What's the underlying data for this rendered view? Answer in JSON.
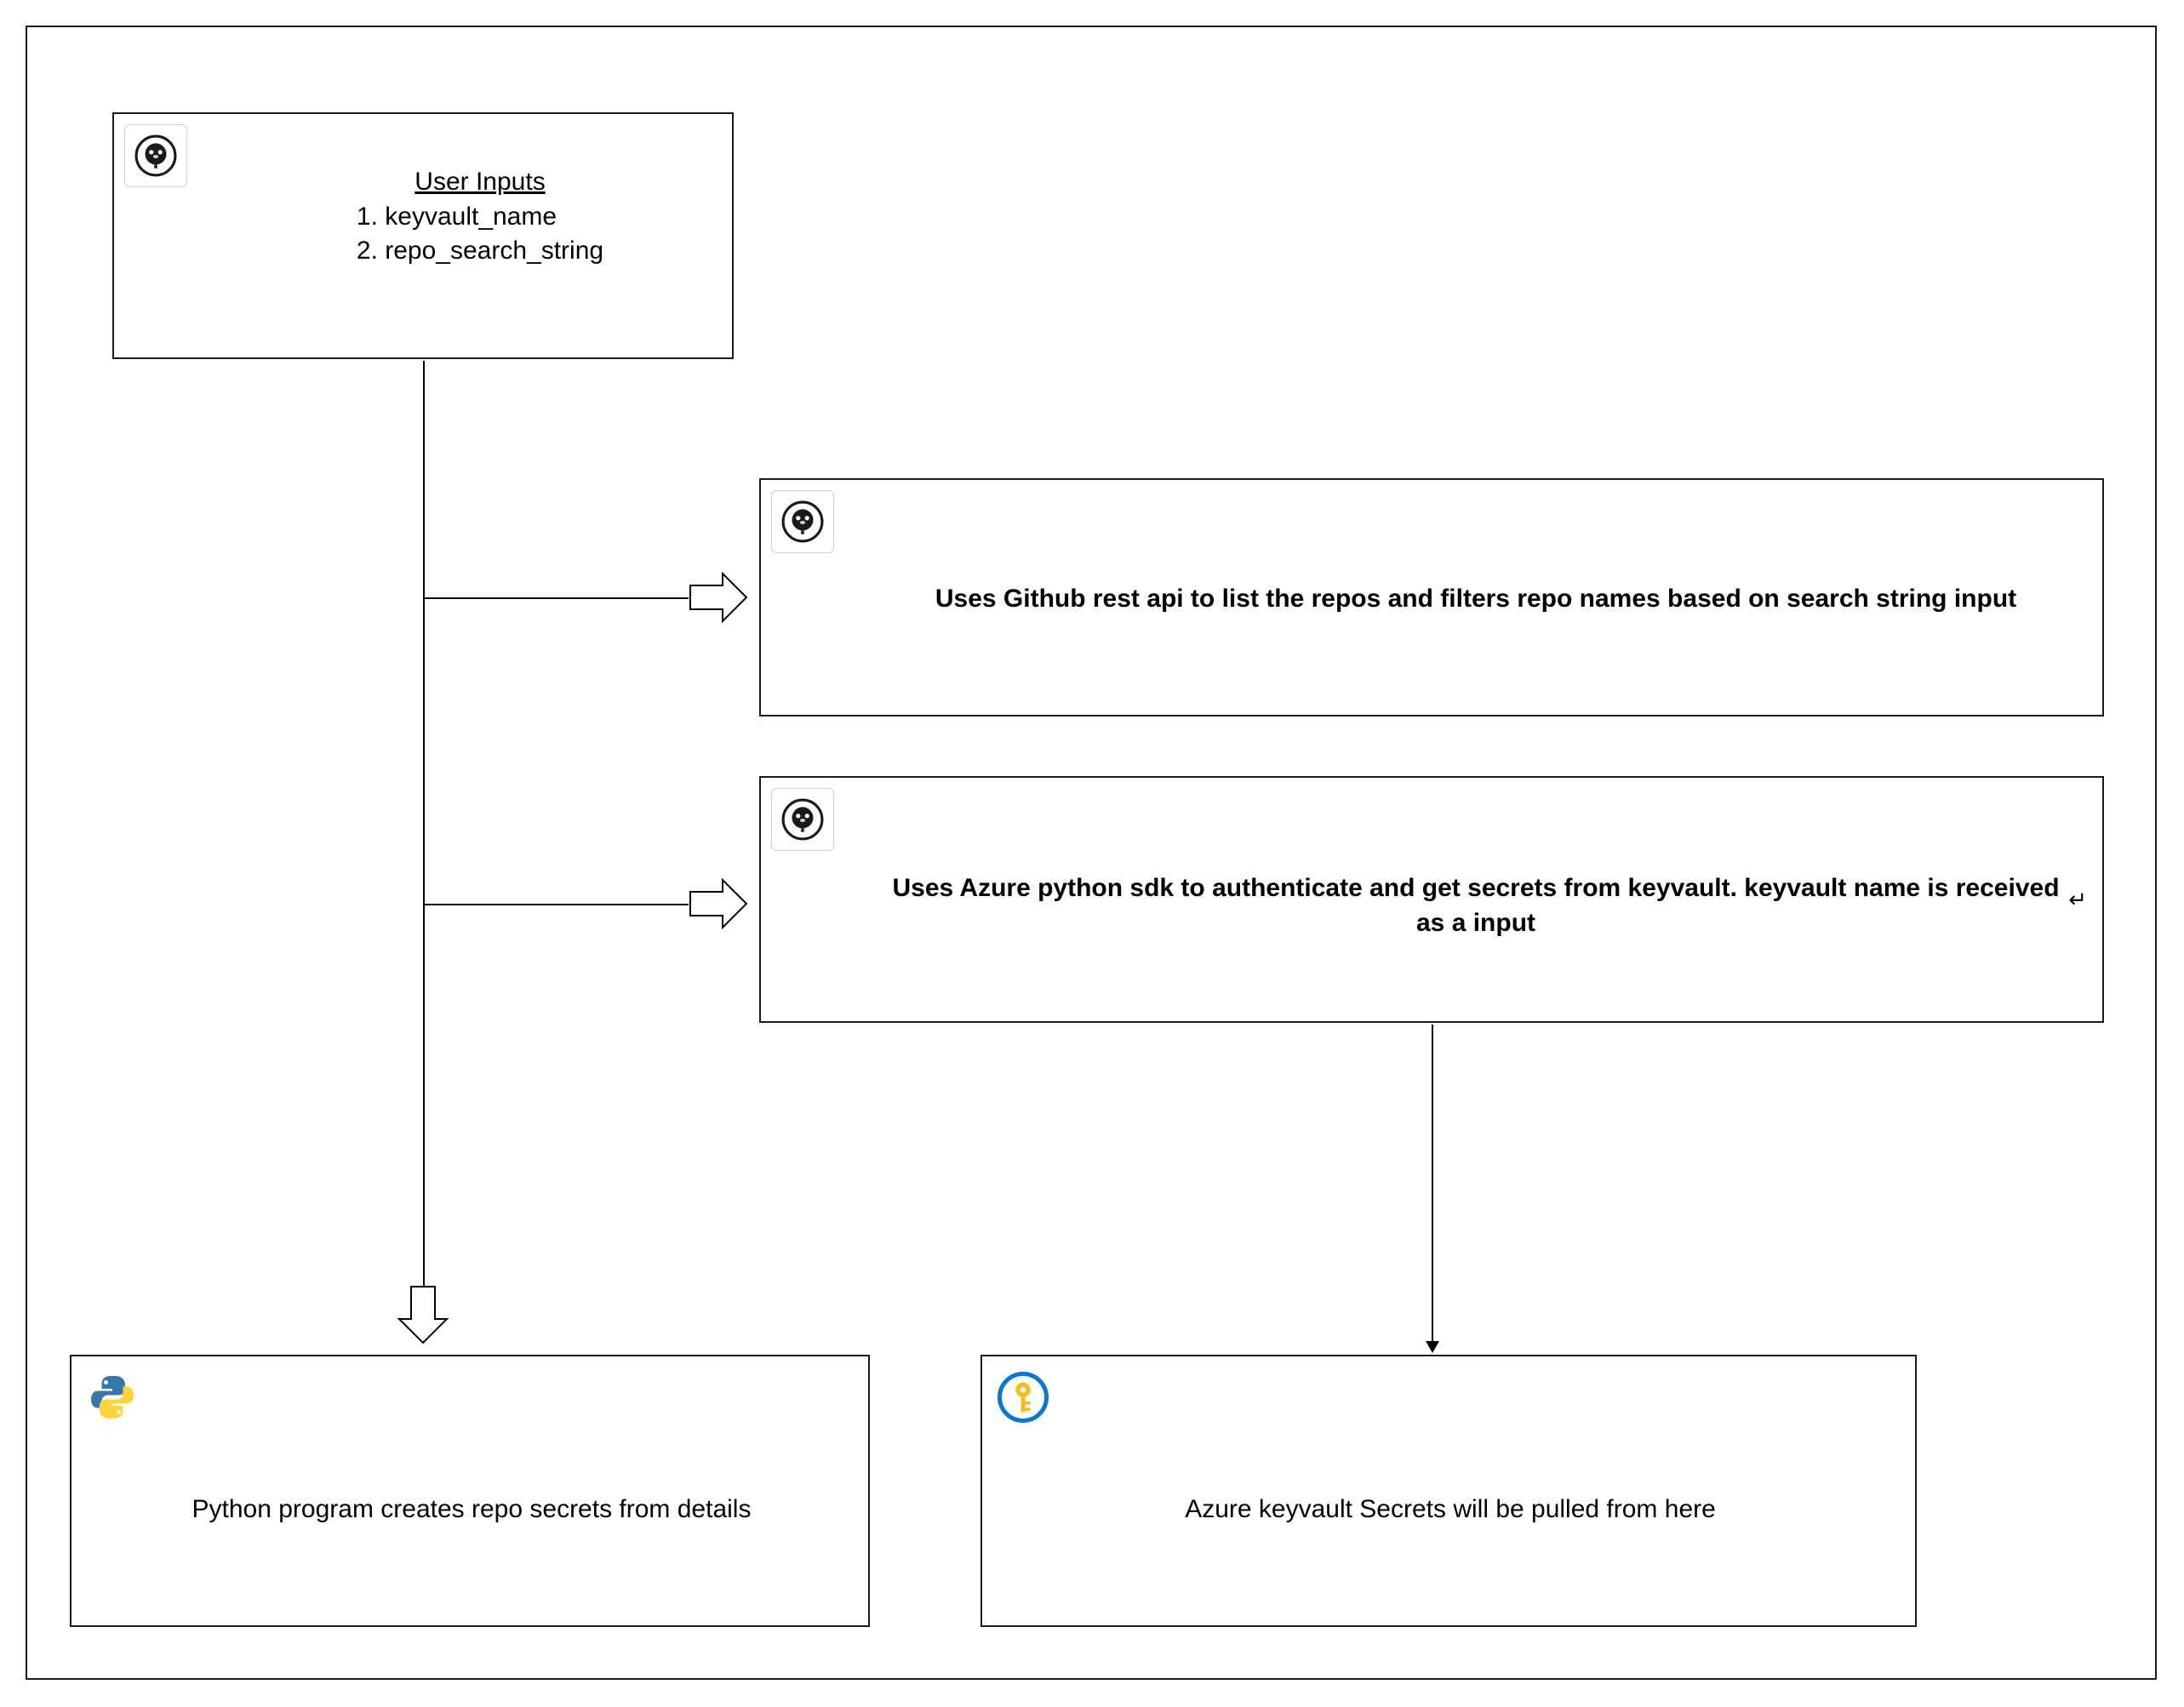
{
  "nodes": {
    "inputs": {
      "title": "User Inputs",
      "line1": "1. keyvault_name",
      "line2": "2. repo_search_string",
      "icon": "github-icon"
    },
    "github_api": {
      "text": "Uses Github rest api to list the repos and filters repo names based on search string input",
      "icon": "github-icon"
    },
    "azure_sdk": {
      "text": "Uses Azure python sdk to authenticate and get secrets from keyvault. keyvault name is received as a input",
      "icon": "github-icon",
      "enter_glyph": "↵"
    },
    "python_program": {
      "text": "Python program  creates repo secrets from details",
      "icon": "python-icon"
    },
    "azure_keyvault": {
      "text": "Azure keyvault Secrets will be pulled from here",
      "icon": "key-icon"
    }
  }
}
